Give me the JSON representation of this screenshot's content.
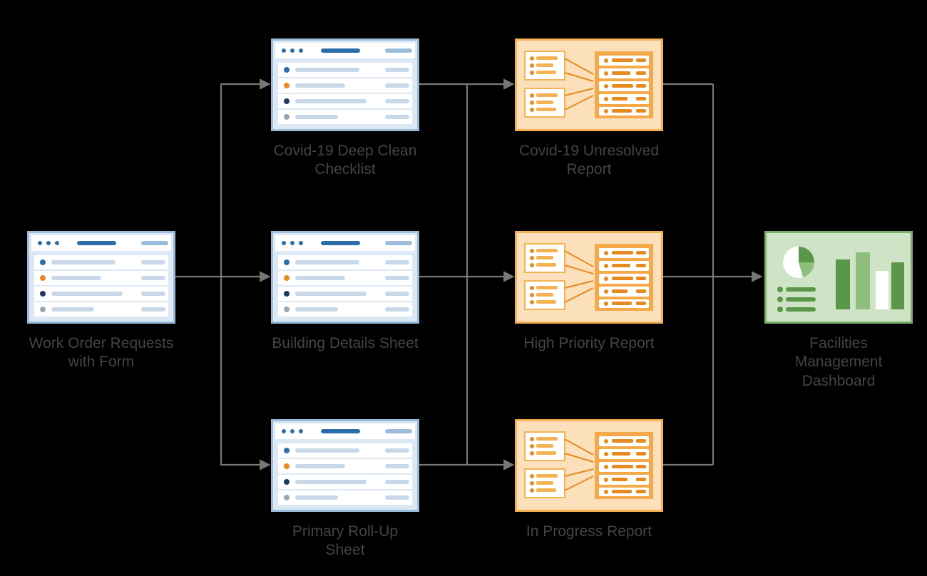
{
  "nodes": {
    "source": {
      "label": "Work Order Requests with Form"
    },
    "sheet1": {
      "label": "Covid-19 Deep Clean Checklist"
    },
    "sheet2": {
      "label": "Building Details Sheet"
    },
    "sheet3": {
      "label": "Primary Roll-Up Sheet"
    },
    "report1": {
      "label": "Covid-19 Unresolved Report"
    },
    "report2": {
      "label": "High Priority Report"
    },
    "report3": {
      "label": "In Progress Report"
    },
    "dashboard": {
      "label": "Facilities Management Dashboard"
    }
  },
  "diagram": {
    "columns": [
      "source",
      "sheets",
      "reports",
      "dashboard"
    ],
    "edges": [
      [
        "source",
        "sheet1"
      ],
      [
        "source",
        "sheet2"
      ],
      [
        "source",
        "sheet3"
      ],
      [
        "sheet1",
        "report1"
      ],
      [
        "sheet2",
        "report2"
      ],
      [
        "sheet3",
        "report3"
      ],
      [
        "report1",
        "dashboard"
      ],
      [
        "report2",
        "dashboard"
      ],
      [
        "report3",
        "dashboard"
      ]
    ]
  },
  "palette": {
    "sheet_frame": "#9BBDDB",
    "sheet_bg": "#DCE8F3",
    "report_frame": "#F5B253",
    "report_bg": "#FBE0BB",
    "report_dark": "#E68A1F",
    "dashboard_frame": "#7AAE6A",
    "dashboard_bg": "#CFE3C6",
    "dashboard_dark": "#5A9748",
    "connector": "#777777",
    "row_line": "#C9D8E8",
    "text": "#444444",
    "dot_blue": "#2C6EAB",
    "dot_orange": "#E68A1F",
    "dot_navy": "#1F3A5F",
    "dot_grey": "#9AA6B2"
  }
}
